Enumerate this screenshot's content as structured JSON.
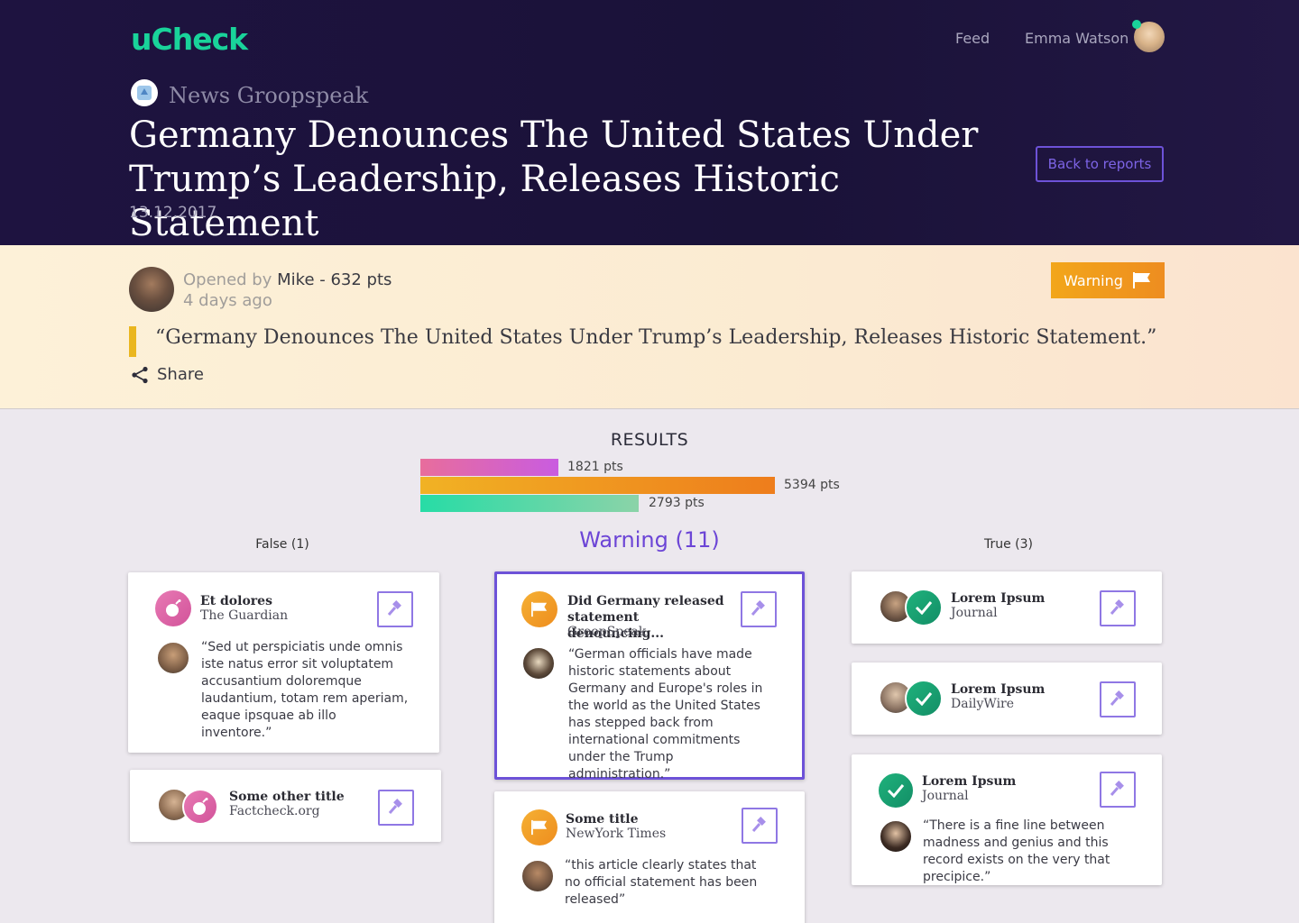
{
  "header": {
    "logo": "uCheck",
    "nav": {
      "feed": "Feed",
      "user": "Emma Watson"
    },
    "source": "News Groopspeak",
    "title": "Germany Denounces The United States Under Trump’s Leadership, Releases Historic Statement",
    "date": "13.12.2017",
    "back_label": "Back to reports"
  },
  "claim": {
    "opened_by_prefix": "Opened by",
    "opened_by_user": "Mike - 632 pts",
    "opened_ago": "4 days ago",
    "warning_label": "Warning",
    "quote": "“Germany Denounces The United States Under Trump’s Leadership, Releases Historic Statement.”",
    "share_label": "Share"
  },
  "results": {
    "title": "RESULTS",
    "bars": [
      {
        "label": "1821 pts",
        "value": 1821
      },
      {
        "label": "5394 pts",
        "value": 5394
      },
      {
        "label": "2793 pts",
        "value": 2793
      }
    ]
  },
  "columns": {
    "false_title": "False (1)",
    "warning_title": "Warning (11)",
    "true_title": "True (3)"
  },
  "cards": {
    "false1": {
      "title": "Et dolores",
      "source": "The Guardian",
      "quote": "“Sed ut perspiciatis unde omnis iste natus error sit voluptatem accusantium doloremque laudantium, totam rem aperiam, eaque ipsquae ab illo inventore.”"
    },
    "false2": {
      "title": "Some other title",
      "source": "Factcheck.org"
    },
    "warn1": {
      "title": "Did Germany released statement denouncing...",
      "source": "GroopSpeak",
      "quote": "“German officials have made historic statements about Germany and Europe's roles in the world as the United States has stepped back from international commitments under the Trump administration.”"
    },
    "warn2": {
      "title": "Some title",
      "source": "NewYork Times",
      "quote": "“this article clearly states that no official statement has been released”"
    },
    "true1": {
      "title": "Lorem Ipsum",
      "source": "Journal"
    },
    "true2": {
      "title": "Lorem Ipsum",
      "source": "DailyWire"
    },
    "true3": {
      "title": "Lorem Ipsum",
      "source": "Journal",
      "quote": "“There is a fine line between madness and genius and this record exists on the very that precipice.”"
    }
  },
  "colors": {
    "accent": "#6d52d8",
    "brand": "#19d39a",
    "warning": "#f2a61a",
    "false": "#d2539a",
    "true": "#1fb27c"
  }
}
